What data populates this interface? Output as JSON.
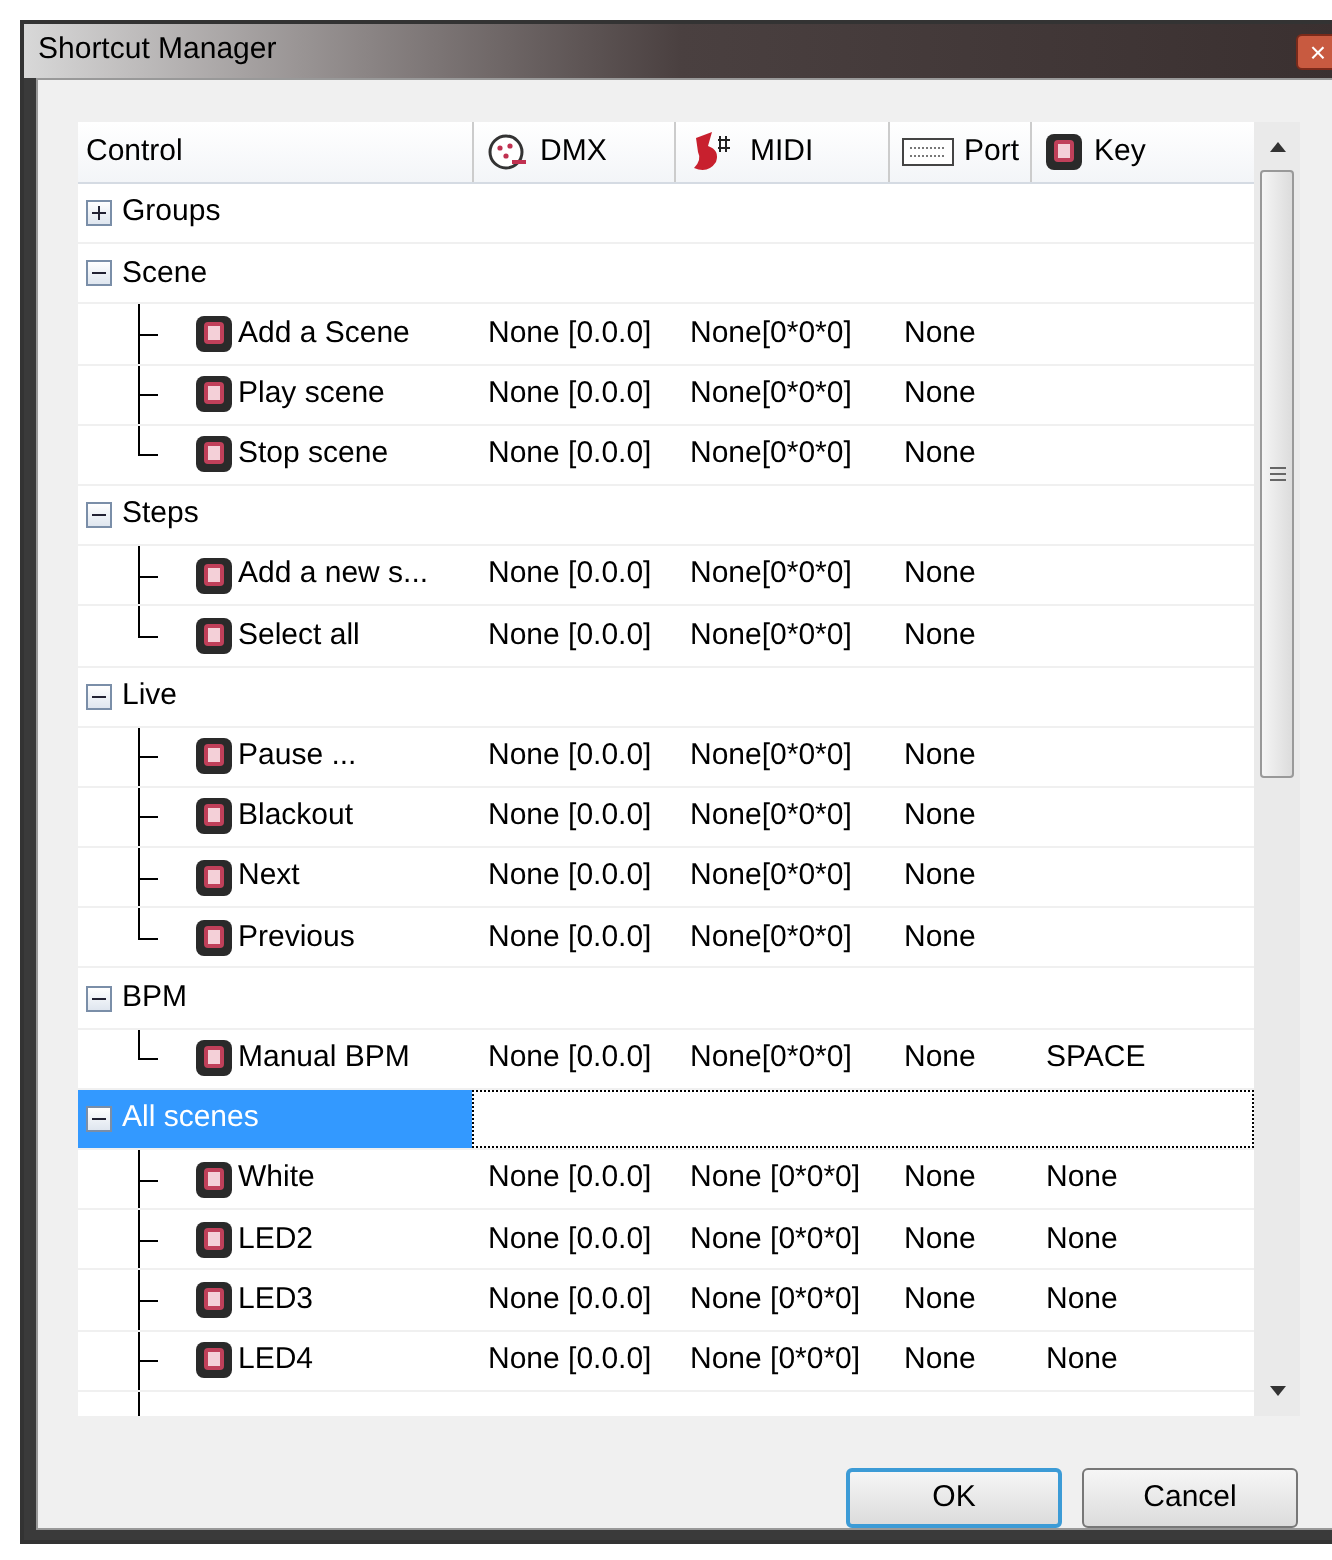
{
  "window": {
    "title": "Shortcut Manager",
    "close": "×"
  },
  "columns": [
    "Control",
    "DMX",
    "MIDI",
    "Port",
    "Key"
  ],
  "groups": [
    {
      "label": "Groups",
      "expanded": false,
      "selected": false
    },
    {
      "label": "Scene",
      "expanded": true,
      "selected": false,
      "children": [
        {
          "label": "Add a Scene",
          "dmx": "None [0.0.0]",
          "midi": "None[0*0*0]",
          "port": "None"
        },
        {
          "label": "Play scene",
          "dmx": "None [0.0.0]",
          "midi": "None[0*0*0]",
          "port": "None"
        },
        {
          "label": "Stop scene",
          "dmx": "None [0.0.0]",
          "midi": "None[0*0*0]",
          "port": "None"
        }
      ]
    },
    {
      "label": "Steps",
      "expanded": true,
      "selected": false,
      "children": [
        {
          "label": "Add a new s...",
          "dmx": "None [0.0.0]",
          "midi": "None[0*0*0]",
          "port": "None"
        },
        {
          "label": "Select all",
          "dmx": "None [0.0.0]",
          "midi": "None[0*0*0]",
          "port": "None"
        }
      ]
    },
    {
      "label": "Live",
      "expanded": true,
      "selected": false,
      "children": [
        {
          "label": "Pause ...",
          "dmx": "None [0.0.0]",
          "midi": "None[0*0*0]",
          "port": "None"
        },
        {
          "label": "Blackout",
          "dmx": "None [0.0.0]",
          "midi": "None[0*0*0]",
          "port": "None"
        },
        {
          "label": "Next",
          "dmx": "None [0.0.0]",
          "midi": "None[0*0*0]",
          "port": "None"
        },
        {
          "label": "Previous",
          "dmx": "None [0.0.0]",
          "midi": "None[0*0*0]",
          "port": "None"
        }
      ]
    },
    {
      "label": "BPM",
      "expanded": true,
      "selected": false,
      "children": [
        {
          "label": "Manual BPM",
          "dmx": "None [0.0.0]",
          "midi": "None[0*0*0]",
          "port": "None",
          "key": "SPACE"
        }
      ]
    },
    {
      "label": "All scenes",
      "expanded": true,
      "selected": true,
      "continues": true,
      "children": [
        {
          "label": "White",
          "dmx": "None [0.0.0]",
          "midi": "None [0*0*0]",
          "port": "None",
          "key": "None"
        },
        {
          "label": "LED2",
          "dmx": "None [0.0.0]",
          "midi": "None [0*0*0]",
          "port": "None",
          "key": "None"
        },
        {
          "label": "LED3",
          "dmx": "None [0.0.0]",
          "midi": "None [0*0*0]",
          "port": "None",
          "key": "None"
        },
        {
          "label": "LED4",
          "dmx": "None [0.0.0]",
          "midi": "None [0*0*0]",
          "port": "None",
          "key": "None"
        }
      ]
    }
  ],
  "buttons": [
    {
      "label": "OK",
      "focused": true
    },
    {
      "label": "Cancel",
      "focused": false
    }
  ]
}
